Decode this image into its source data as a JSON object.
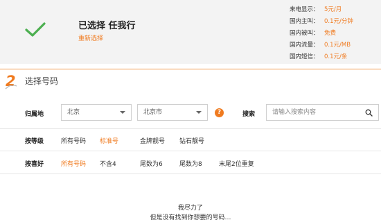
{
  "selected": {
    "title": "已选择 任我行",
    "reselect_label": "重新选择"
  },
  "fees": [
    {
      "label": "来电显示：",
      "value": "5元/月"
    },
    {
      "label": "国内主叫：",
      "value": "0.1元/分钟"
    },
    {
      "label": "国内被叫：",
      "value": "免费"
    },
    {
      "label": "国内流量：",
      "value": "0.1元/MB"
    },
    {
      "label": "国内短信：",
      "value": "0.1元/条"
    }
  ],
  "section": {
    "step_number": "2",
    "title": "选择号码"
  },
  "location": {
    "label": "归属地",
    "province": "北京",
    "city": "北京市",
    "help": "?"
  },
  "search": {
    "label": "搜索",
    "placeholder": "请输入搜索内容"
  },
  "grade": {
    "label": "按等级",
    "options": [
      "所有号码",
      "标准号",
      "金牌靓号",
      "钻石靓号"
    ],
    "active_index": 1
  },
  "preference": {
    "label": "按喜好",
    "options": [
      "所有号码",
      "不含4",
      "尾数为6",
      "尾数为8",
      "末尾2位重复"
    ],
    "active_index": 0
  },
  "empty_state": {
    "line1": "我尽力了",
    "line2": "但是没有找到你想要的号码…"
  },
  "colors": {
    "accent": "#f07b20",
    "check": "#4caf50"
  }
}
